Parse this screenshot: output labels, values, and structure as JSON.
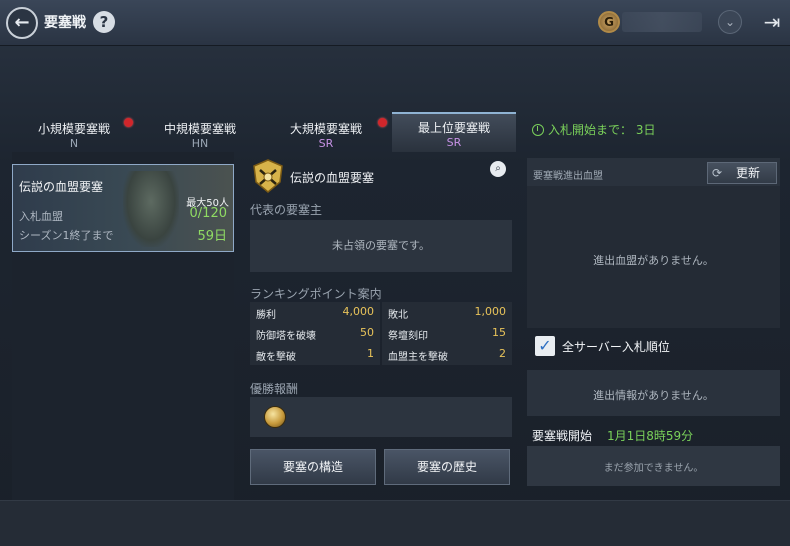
{
  "header": {
    "title": "要塞戦",
    "back_icon": "back-arrow-icon",
    "help_label": "?",
    "currency_label": "G",
    "collapse_label": "⌄",
    "exit_label": "⇥"
  },
  "tabs": [
    {
      "name": "小規模要塞戦",
      "grade": "N",
      "grade_color": "#9aa6b4",
      "has_alert": true,
      "active": false
    },
    {
      "name": "中規模要塞戦",
      "grade": "HN",
      "grade_color": "#9aa6b4",
      "has_alert": false,
      "active": false
    },
    {
      "name": "大規模要塞戦",
      "grade": "SR",
      "grade_color": "#c792e6",
      "has_alert": true,
      "active": false
    },
    {
      "name": "最上位要塞戦",
      "grade": "SR",
      "grade_color": "#c792e6",
      "has_alert": false,
      "active": true
    }
  ],
  "bid_countdown": "入札開始まで： 3日",
  "fortress_card": {
    "title": "伝説の血盟要塞",
    "max_members": "最大50人",
    "bid_label": "入札血盟",
    "bid_value": "0/120",
    "season_label": "シーズン1終了まで",
    "days_left": "59日"
  },
  "detail": {
    "fortress_name": "伝説の血盟要塞",
    "owner_section": "代表の要塞主",
    "owner_empty": "未占領の要塞です。",
    "ranking_section": "ランキングポイント案内",
    "points": [
      {
        "left_label": "勝利",
        "left_value": "4,000",
        "right_label": "敗北",
        "right_value": "1,000"
      },
      {
        "left_label": "防御塔を破壊",
        "left_value": "50",
        "right_label": "祭壇刻印",
        "right_value": "15"
      },
      {
        "left_label": "敵を撃破",
        "left_value": "1",
        "right_label": "血盟主を撃破",
        "right_value": "2"
      }
    ],
    "reward_section": "優勝報酬",
    "structure_button": "要塞の構造",
    "history_button": "要塞の歴史"
  },
  "right_panel": {
    "header": "要塞戦進出血盟",
    "refresh_label": "更新",
    "no_clans": "進出血盟がありません。",
    "checkbox_label": "全サーバー入札順位",
    "checkbox_checked": true,
    "no_info": "進出情報がありません。",
    "war_start_label": "要塞戦開始",
    "war_start_date": "1月1日8時59分",
    "cannot_join": "まだ参加できません。"
  }
}
